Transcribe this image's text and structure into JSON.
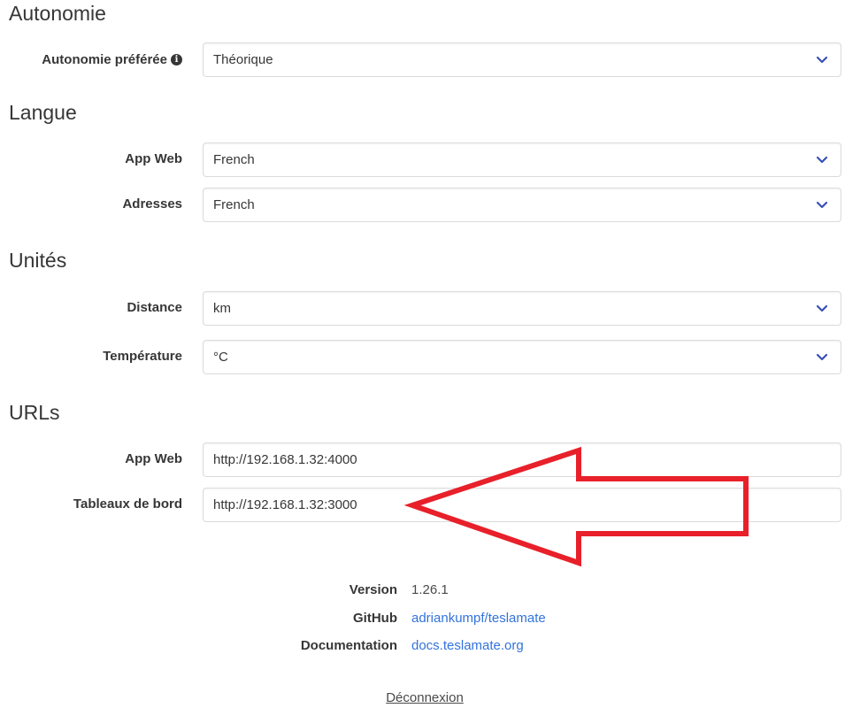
{
  "sections": {
    "range": {
      "title": "Autonomie",
      "preferred_range_label": "Autonomie préférée",
      "preferred_range_value": "Théorique"
    },
    "language": {
      "title": "Langue",
      "web_app_label": "App Web",
      "web_app_value": "French",
      "addresses_label": "Adresses",
      "addresses_value": "French"
    },
    "units": {
      "title": "Unités",
      "distance_label": "Distance",
      "distance_value": "km",
      "temperature_label": "Température",
      "temperature_value": "°C"
    },
    "urls": {
      "title": "URLs",
      "web_app_label": "App Web",
      "web_app_value": "http://192.168.1.32:4000",
      "dashboards_label": "Tableaux de bord",
      "dashboards_value": "http://192.168.1.32:3000"
    }
  },
  "footer": {
    "version_label": "Version",
    "version_value": "1.26.1",
    "github_label": "GitHub",
    "github_value": "adriankumpf/teslamate",
    "docs_label": "Documentation",
    "docs_value": "docs.teslamate.org",
    "logout_label": "Déconnexion"
  },
  "icons": {
    "info": "info-icon",
    "dropdown": "chevron-down-icon",
    "annotation": "red-arrow-annotation"
  },
  "colors": {
    "text": "#363636",
    "link": "#3273dc",
    "chevron": "#3850b7",
    "annotation": "#e8202a",
    "border": "#dbdbdb"
  }
}
